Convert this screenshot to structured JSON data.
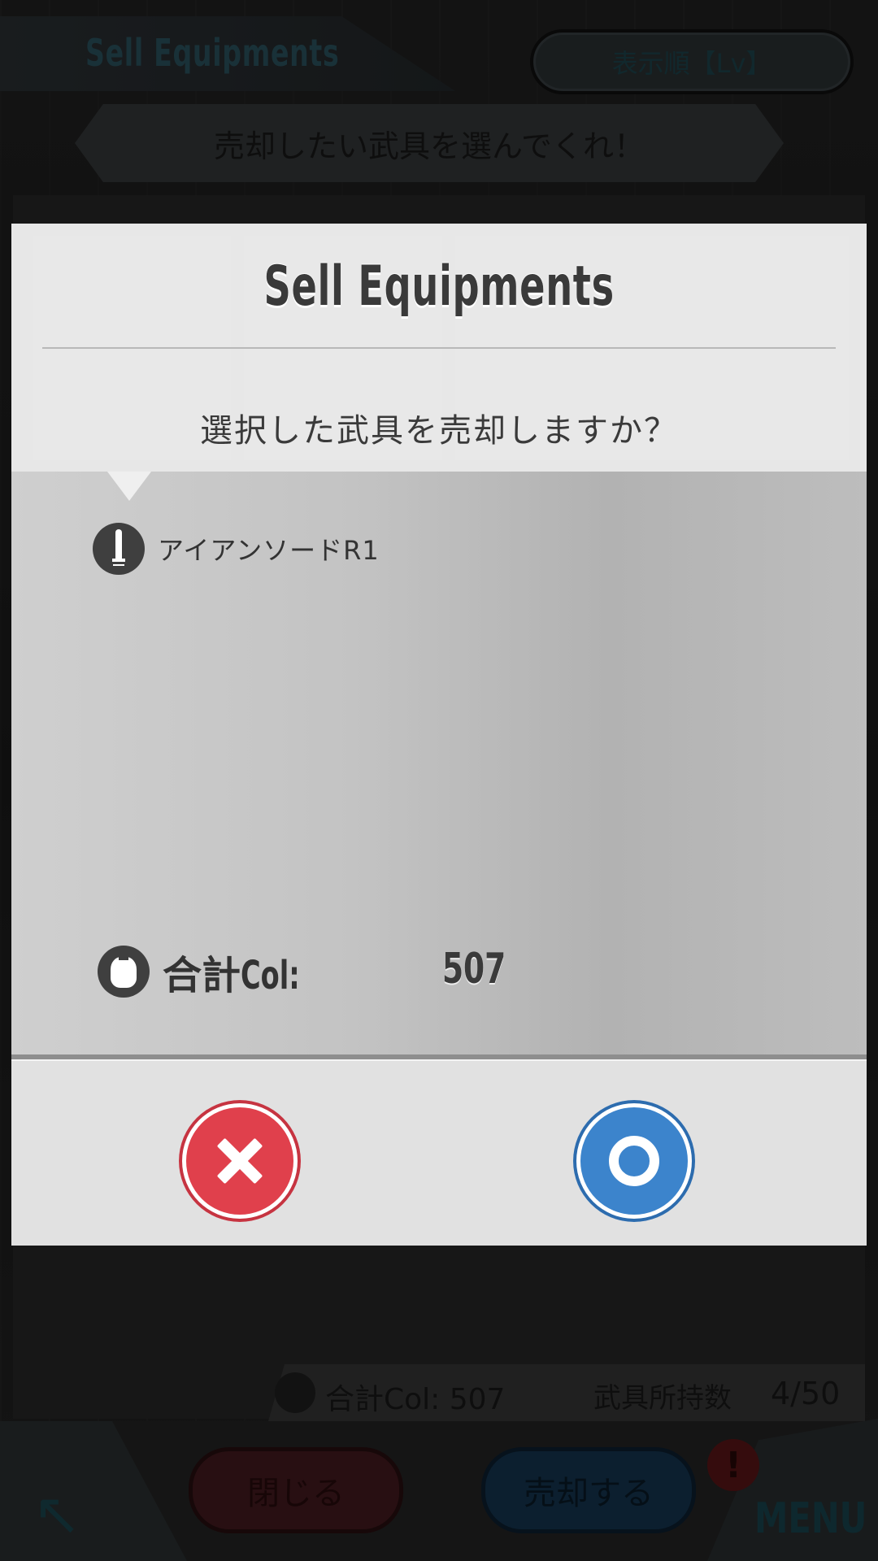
{
  "screen": {
    "title": "Sell Equipments",
    "sort_label": "表示順【Lv】",
    "instruction": "売却したい武具を選んでくれ！",
    "total_label": "合計Col: 507",
    "owned_label": "武具所持数",
    "owned_value": "4/50",
    "close_label": "閉じる",
    "sell_label": "売却する",
    "alert_icon": "!",
    "menu_label": "MENU",
    "back_icon": "back-arrow-icon"
  },
  "dialog": {
    "title": "Sell Equipments",
    "question": "選択した武具を売却しますか？",
    "items": [
      {
        "icon": "sword-icon",
        "name": "アイアンソードR1"
      }
    ],
    "total": {
      "icon": "money-bag-icon",
      "label_prefix": "合計",
      "label_col": "Col:",
      "value": "507"
    },
    "cancel_icon": "close-x-icon",
    "confirm_icon": "confirm-o-icon"
  },
  "colors": {
    "cancel": "#e0404c",
    "confirm": "#3c84cc",
    "dialog_header": "#f0f0f0",
    "dialog_body": "#c3c3c3"
  }
}
